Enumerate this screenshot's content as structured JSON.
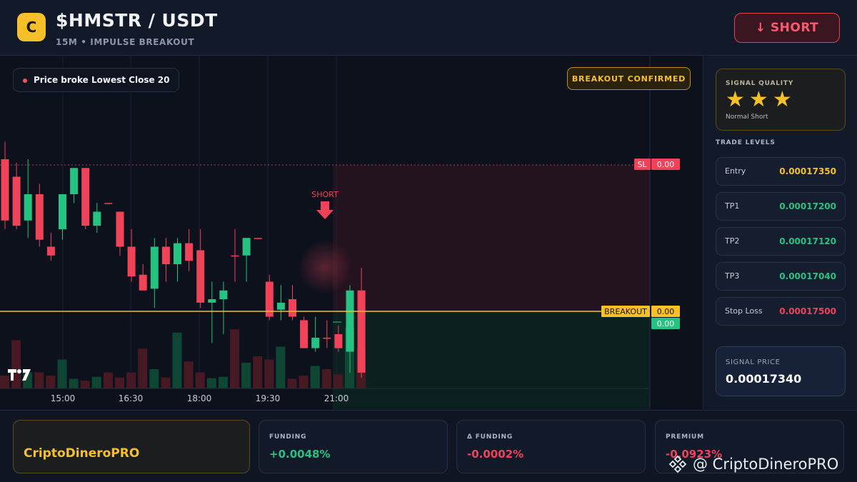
{
  "header": {
    "logo_letter": "C",
    "pair": "$HMSTR / USDT",
    "subtitle": "15M • IMPULSE BREAKOUT",
    "action_label": "↓ SHORT"
  },
  "chart": {
    "message": "Price broke Lowest Close 20",
    "badge": "BREAKOUT CONFIRMED",
    "short_marker": "SHORT",
    "sl_label": "SL",
    "sl_value": "0.00",
    "breakout_label": "BREAKOUT",
    "breakout_value": "0.00",
    "price_value": "0.00",
    "tv_logo": "TV",
    "x_ticks": [
      "15:00",
      "16:30",
      "18:00",
      "19:30",
      "21:00"
    ],
    "colors": {
      "up": "#26c281",
      "down": "#f0435a",
      "breakout": "#f5c02a"
    }
  },
  "chart_data": {
    "type": "candlestick",
    "x_ticks": [
      "15:00",
      "16:30",
      "18:00",
      "19:30",
      "21:00"
    ],
    "candles": [
      {
        "o": 0.2,
        "h": 0.1,
        "l": 0.6,
        "c": 0.55
      },
      {
        "o": 0.3,
        "h": 0.22,
        "l": 0.6,
        "c": 0.58
      },
      {
        "o": 0.55,
        "h": 0.2,
        "l": 0.65,
        "c": 0.4
      },
      {
        "o": 0.4,
        "h": 0.34,
        "l": 0.7,
        "c": 0.66
      },
      {
        "o": 0.7,
        "h": 0.62,
        "l": 0.78,
        "c": 0.75
      },
      {
        "o": 0.6,
        "h": 0.4,
        "l": 0.66,
        "c": 0.4
      },
      {
        "o": 0.4,
        "h": 0.25,
        "l": 0.45,
        "c": 0.25
      },
      {
        "o": 0.25,
        "h": 0.25,
        "l": 0.6,
        "c": 0.58
      },
      {
        "o": 0.58,
        "h": 0.45,
        "l": 0.62,
        "c": 0.5
      },
      {
        "o": 0.45,
        "h": 0.45,
        "l": 0.45,
        "c": 0.45
      },
      {
        "o": 0.5,
        "h": 0.5,
        "l": 0.75,
        "c": 0.7
      },
      {
        "o": 0.7,
        "h": 0.6,
        "l": 0.9,
        "c": 0.87
      },
      {
        "o": 0.86,
        "h": 0.8,
        "l": 0.95,
        "c": 0.95
      },
      {
        "o": 0.94,
        "h": 0.65,
        "l": 1.05,
        "c": 0.7
      },
      {
        "o": 0.7,
        "h": 0.65,
        "l": 0.9,
        "c": 0.8
      },
      {
        "o": 0.8,
        "h": 0.65,
        "l": 0.9,
        "c": 0.68
      },
      {
        "o": 0.68,
        "h": 0.6,
        "l": 0.84,
        "c": 0.78
      },
      {
        "o": 0.72,
        "h": 0.6,
        "l": 1.05,
        "c": 1.02
      },
      {
        "o": 1.02,
        "h": 0.9,
        "l": 1.25,
        "c": 1.0
      },
      {
        "o": 1.0,
        "h": 0.9,
        "l": 1.2,
        "c": 0.95
      },
      {
        "o": 0.75,
        "h": 0.6,
        "l": 0.9,
        "c": 0.75
      },
      {
        "o": 0.75,
        "h": 0.65,
        "l": 0.9,
        "c": 0.65
      },
      {
        "o": 0.65,
        "h": 0.65,
        "l": 0.65,
        "c": 0.65
      },
      {
        "o": 0.9,
        "h": 0.86,
        "l": 1.12,
        "c": 1.1
      },
      {
        "o": 1.06,
        "h": 0.92,
        "l": 1.12,
        "c": 1.02
      },
      {
        "o": 1.0,
        "h": 0.92,
        "l": 1.12,
        "c": 1.1
      },
      {
        "o": 1.12,
        "h": 1.1,
        "l": 1.28,
        "c": 1.28
      },
      {
        "o": 1.28,
        "h": 1.1,
        "l": 1.3,
        "c": 1.22
      },
      {
        "o": 1.22,
        "h": 1.12,
        "l": 1.28,
        "c": 1.22
      },
      {
        "o": 1.2,
        "h": 1.15,
        "l": 1.3,
        "c": 1.28
      },
      {
        "o": 1.3,
        "h": 0.92,
        "l": 1.42,
        "c": 0.95
      },
      {
        "o": 0.95,
        "h": 0.82,
        "l": 1.45,
        "c": 1.42
      }
    ],
    "volume": [
      0.2,
      0.75,
      0.25,
      0.25,
      0.2,
      0.45,
      0.15,
      0.12,
      0.18,
      0.25,
      0.17,
      0.25,
      0.62,
      0.3,
      0.17,
      0.87,
      0.42,
      0.25,
      0.16,
      0.18,
      0.92,
      0.4,
      0.5,
      0.45,
      0.65,
      0.15,
      0.2,
      0.35,
      0.3,
      0.22,
      0.95,
      0.62
    ],
    "levels": {
      "stop_loss": 0.0,
      "breakout": 0.0,
      "current": 0.0
    }
  },
  "signal_quality": {
    "title": "SIGNAL QUALITY",
    "stars": 3,
    "star_glyph": "★",
    "subtitle": "Normal Short"
  },
  "trade_levels": {
    "title": "TRADE LEVELS",
    "rows": [
      {
        "label": "Entry",
        "value": "0.00017350",
        "color": "#f5c02a"
      },
      {
        "label": "TP1",
        "value": "0.00017200",
        "color": "#26c281"
      },
      {
        "label": "TP2",
        "value": "0.00017120",
        "color": "#26c281"
      },
      {
        "label": "TP3",
        "value": "0.00017040",
        "color": "#26c281"
      },
      {
        "label": "Stop Loss",
        "value": "0.00017500",
        "color": "#f0435a"
      }
    ]
  },
  "signal_price": {
    "title": "SIGNAL PRICE",
    "value": "0.00017340"
  },
  "footer": {
    "brand": "CriptoDineroPRO",
    "stats": [
      {
        "title": "FUNDING",
        "value": "+0.0048%",
        "color": "#26c281"
      },
      {
        "title": "Δ FUNDING",
        "value": "-0.0002%",
        "color": "#f0435a"
      },
      {
        "title": "PREMIUM",
        "value": "-0.0923%",
        "color": "#f0435a"
      }
    ],
    "watermark": "@ CriptoDineroPRO"
  }
}
